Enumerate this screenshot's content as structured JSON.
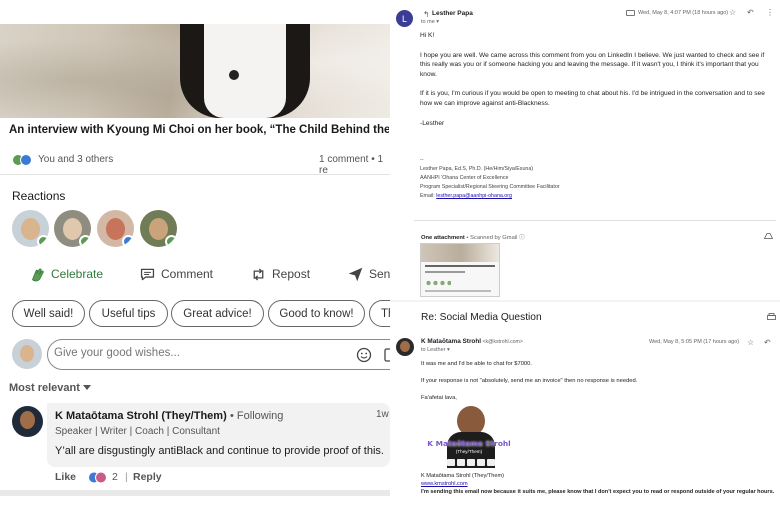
{
  "linkedin": {
    "post_title": "An interview with Kyoung Mi Choi on her book, “The Child Behind the Bu...",
    "reaction_summary": "You and 3 others",
    "comment_count": "1 comment • 1 re",
    "reactions_heading": "Reactions",
    "actions": {
      "celebrate": "Celebrate",
      "comment": "Comment",
      "repost": "Repost",
      "send": "Send"
    },
    "suggestions": [
      "Well said!",
      "Useful tips",
      "Great advice!",
      "Good to know!",
      "Th"
    ],
    "compose_placeholder": "Give your good wishes...",
    "sort_label": "Most relevant",
    "comment": {
      "author": "K Mataōtama Strohl (They/Them)",
      "following": "• Following",
      "time": "1w",
      "headline": "Speaker | Writer | Coach | Consultant",
      "text": "Y’all are disgustingly antiBlack and continue to provide proof of this.",
      "like_label": "Like",
      "reaction_count": "2",
      "separator": "|",
      "reply_label": "Reply"
    }
  },
  "gmail_message": {
    "avatar_letter": "L",
    "sender": "Lesther Papa",
    "to": "to me ▾",
    "date": "Wed, May 8, 4:07 PM (18 hours ago)",
    "body": [
      "Hi K!",
      "I hope you are well. We came across this comment from you on LinkedIn I believe. We just wanted to check and see if this really was you or if someone hacking you and leaving the message. If it wasn't you, I think it's important that you know.",
      "If it is you, I'm curious if you would be open to meeting to chat about his. I'd be intrigued in the conversation and to see how we can improve against anti-Blackness.",
      "-Lesther"
    ],
    "signature": {
      "dash": "--",
      "line1": "Lesther Papa, Ed.S, Ph.D. (He/Him/Siya/Esuna)",
      "line2": "AANHPI 'Ohana Center of Excellence",
      "line3": "Program Specialist/Regional Steering Committee Facilitator",
      "email_label": "Email: ",
      "email": "lesther.papa@aanhpi-ohana.org"
    },
    "attachment_heading": "One attachment",
    "scanned": " • Scanned by Gmail ⓘ"
  },
  "gmail_reply": {
    "subject": "Re: Social Media Question",
    "sender": "K Mataōtama Strohl",
    "sender_email": " <k@kstrohl.com>",
    "to": "to Lesther ▾",
    "date": "Wed, May 8, 5:05 PM (17 hours ago)",
    "body": [
      "It was me and I'd be able to chat for $7000.",
      "If your response is not \"absolutely, send me an invoice\" then no response is needed.",
      "Fa'afetai lava,"
    ],
    "banner_name": "K Mataōtama Strohl",
    "banner_pronouns": "(They/Them)",
    "signature": {
      "name": "K Mataōtama Strohl (They/Them)",
      "website": "www.kmstrohl.com",
      "note": "I'm sending this email now because it suits me, please know that I don't expect you to read or respond outside of your regular hours."
    }
  },
  "colors": {
    "celebrate_green": "#2f7a3a",
    "like_blue": "#3d7ad6",
    "gmail_avatar": "#3b3c96",
    "link_blue": "#1a0dab"
  }
}
